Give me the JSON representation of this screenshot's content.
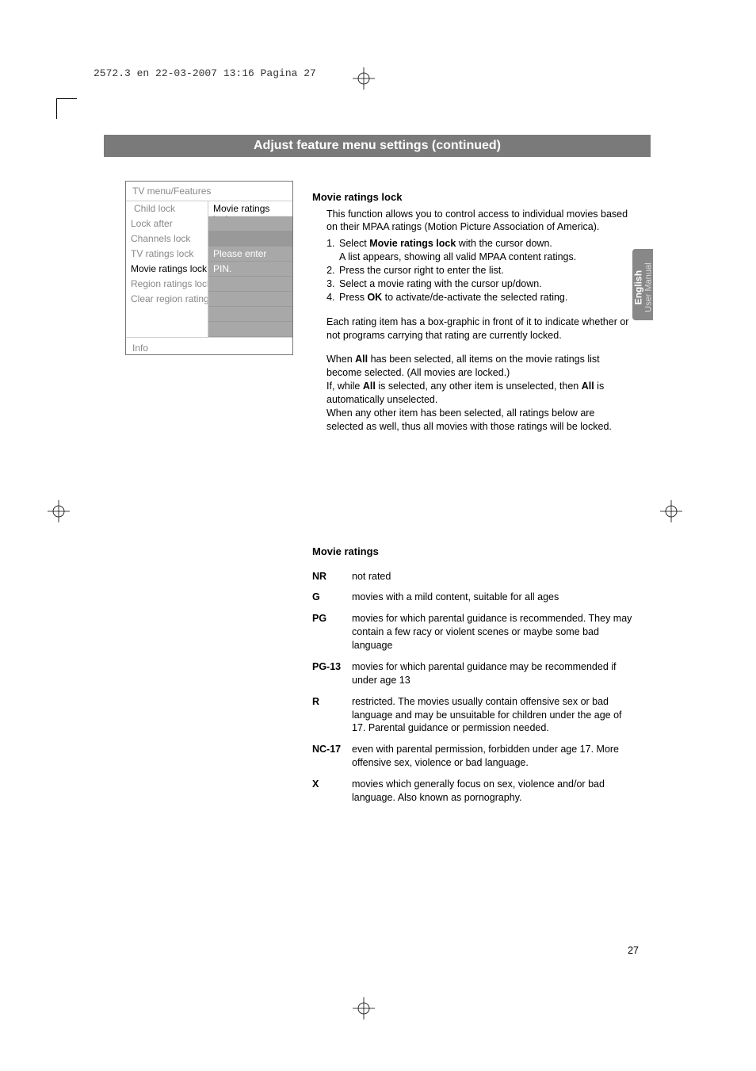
{
  "print_header": "2572.3 en  22-03-2007  13:16  Pagina 27",
  "title_bar": "Adjust feature menu settings   (continued)",
  "menu": {
    "header": "TV menu/Features",
    "left": [
      "Child lock",
      "Lock after",
      "Channels lock",
      "TV ratings lock",
      "Movie ratings lock",
      "Region ratings lock",
      "Clear region ratings"
    ],
    "right_label": "Movie ratings lock",
    "right_msg_a": "Please enter your",
    "right_msg_b": "PIN.",
    "info": "Info"
  },
  "body": {
    "heading": "Movie ratings lock",
    "intro": "This function allows you to control access to individual movies based on their MPAA ratings (Motion Picture Association of America).",
    "steps_raw": {
      "s1a": "Select ",
      "s1b": "Movie ratings lock",
      "s1c": " with the cursor down.",
      "s1d": "A list appears, showing all valid MPAA content ratings.",
      "s2": "Press the cursor right to enter the list.",
      "s3": "Select a movie rating with the cursor up/down.",
      "s4a": "Press ",
      "s4b": "OK",
      "s4c": " to activate/de-activate the selected rating."
    },
    "note1": "Each rating item has a box-graphic in front of it to indicate whether or not programs carrying that rating are currently locked.",
    "note2a": "When ",
    "note2b": "All",
    "note2c": " has been selected, all items on the movie ratings list become selected. (All movies are locked.)",
    "note3a": "If, while ",
    "note3b": "All",
    "note3c": " is selected, any other item is unselected, then ",
    "note3d": "All",
    "note3e": " is automatically unselected.",
    "note4": "When any other item has been selected, all ratings below are selected as well, thus all movies with those ratings will be locked."
  },
  "side_tab": {
    "main": "English",
    "sub": "User Manual"
  },
  "ratings": {
    "heading": "Movie ratings",
    "items": [
      {
        "code": "NR",
        "desc": "not rated"
      },
      {
        "code": "G",
        "desc": "movies with a mild content, suitable for all ages"
      },
      {
        "code": "PG",
        "desc": "movies for which parental guidance is recommended. They may contain a few racy or violent scenes or maybe some bad language"
      },
      {
        "code": "PG-13",
        "desc": "movies for which parental guidance may be recommended if under age 13"
      },
      {
        "code": "R",
        "desc": "restricted. The movies usually contain offensive sex or bad language and may be unsuitable for children under the age of 17. Parental guidance or permission needed."
      },
      {
        "code": "NC-17",
        "desc": "even with parental permission, forbidden under age 17. More offensive sex, violence or bad language."
      },
      {
        "code": "X",
        "desc": "movies which generally focus on sex, violence and/or bad language. Also known as pornography."
      }
    ]
  },
  "page_number": "27"
}
